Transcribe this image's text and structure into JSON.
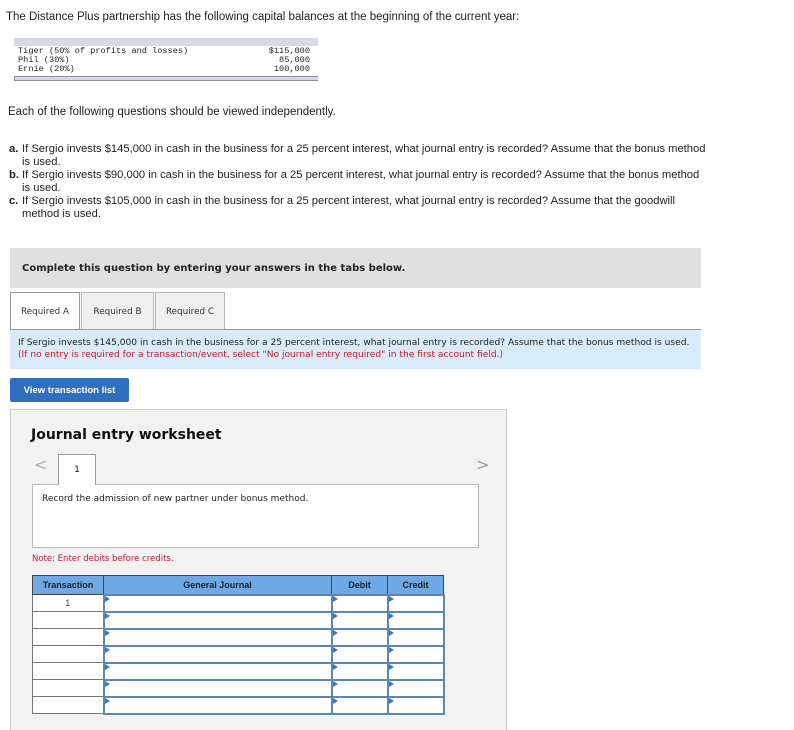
{
  "intro": "The Distance Plus partnership has the following capital balances at the beginning of the current year:",
  "balances": [
    {
      "partner": "Tiger (50% of profits and losses)",
      "amount": "$115,000"
    },
    {
      "partner": "Phil (30%)",
      "amount": "85,000"
    },
    {
      "partner": "Ernie (20%)",
      "amount": "100,000"
    }
  ],
  "independent_note": "Each of the following questions should be viewed independently.",
  "questions": [
    {
      "label": "a.",
      "text": "If Sergio invests $145,000 in cash in the business for a 25 percent interest, what journal entry is recorded? Assume that the bonus method is used."
    },
    {
      "label": "b.",
      "text": "If Sergio invests $90,000 in cash in the business for a 25 percent interest, what journal entry is recorded? Assume that the bonus method is used."
    },
    {
      "label": "c.",
      "text": "If Sergio invests $105,000 in cash in the business for a 25 percent interest, what journal entry is recorded? Assume that the goodwill method is used."
    }
  ],
  "instructions": "Complete this question by entering your answers in the tabs below.",
  "tabs": [
    {
      "label": "Required A",
      "active": true
    },
    {
      "label": "Required B",
      "active": false
    },
    {
      "label": "Required C",
      "active": false
    }
  ],
  "prompt": {
    "text": "If Sergio invests $145,000 in cash in the business for a 25 percent interest, what journal entry is recorded? Assume that the bonus method is used.",
    "note": "(If no entry is required for a transaction/event, select \"No journal entry required\" in the first account field.)"
  },
  "view_transaction_button": "View transaction list",
  "worksheet": {
    "title": "Journal entry worksheet",
    "prev_icon": "<",
    "next_icon": ">",
    "current_tab": "1",
    "description": "Record the admission of new partner under bonus method.",
    "note": "Note: Enter debits before credits.",
    "columns": [
      "Transaction",
      "General Journal",
      "Debit",
      "Credit"
    ],
    "rows": [
      {
        "transaction": "1",
        "account": "",
        "debit": "",
        "credit": ""
      },
      {
        "transaction": "",
        "account": "",
        "debit": "",
        "credit": ""
      },
      {
        "transaction": "",
        "account": "",
        "debit": "",
        "credit": ""
      },
      {
        "transaction": "",
        "account": "",
        "debit": "",
        "credit": ""
      },
      {
        "transaction": "",
        "account": "",
        "debit": "",
        "credit": ""
      },
      {
        "transaction": "",
        "account": "",
        "debit": "",
        "credit": ""
      },
      {
        "transaction": "",
        "account": "",
        "debit": "",
        "credit": ""
      }
    ]
  },
  "colors": {
    "tab_instructions_bg": "#e0e0e0",
    "prompt_bg": "#d8ebf9",
    "alert_red": "#c5192d",
    "button_blue": "#2f6fbf",
    "table_header_blue": "#6ea9e6"
  }
}
